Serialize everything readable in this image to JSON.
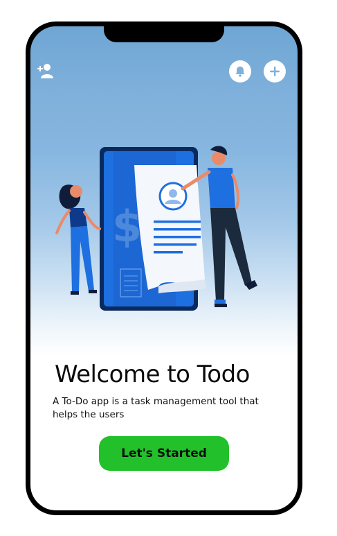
{
  "header": {
    "icons": {
      "add_user": "add-user-icon",
      "notifications": "bell-icon",
      "add": "plus-icon"
    }
  },
  "hero": {
    "illustration": "phone-receipt-people-illustration"
  },
  "welcome": {
    "title": "Welcome to Todo",
    "subtitle": "A To-Do app is a task management tool that helps the users",
    "cta_label": "Let's Started"
  },
  "colors": {
    "accent": "#22c12b",
    "header_blue": "#7fb0db",
    "icon_blue": "#1e6fe0"
  }
}
